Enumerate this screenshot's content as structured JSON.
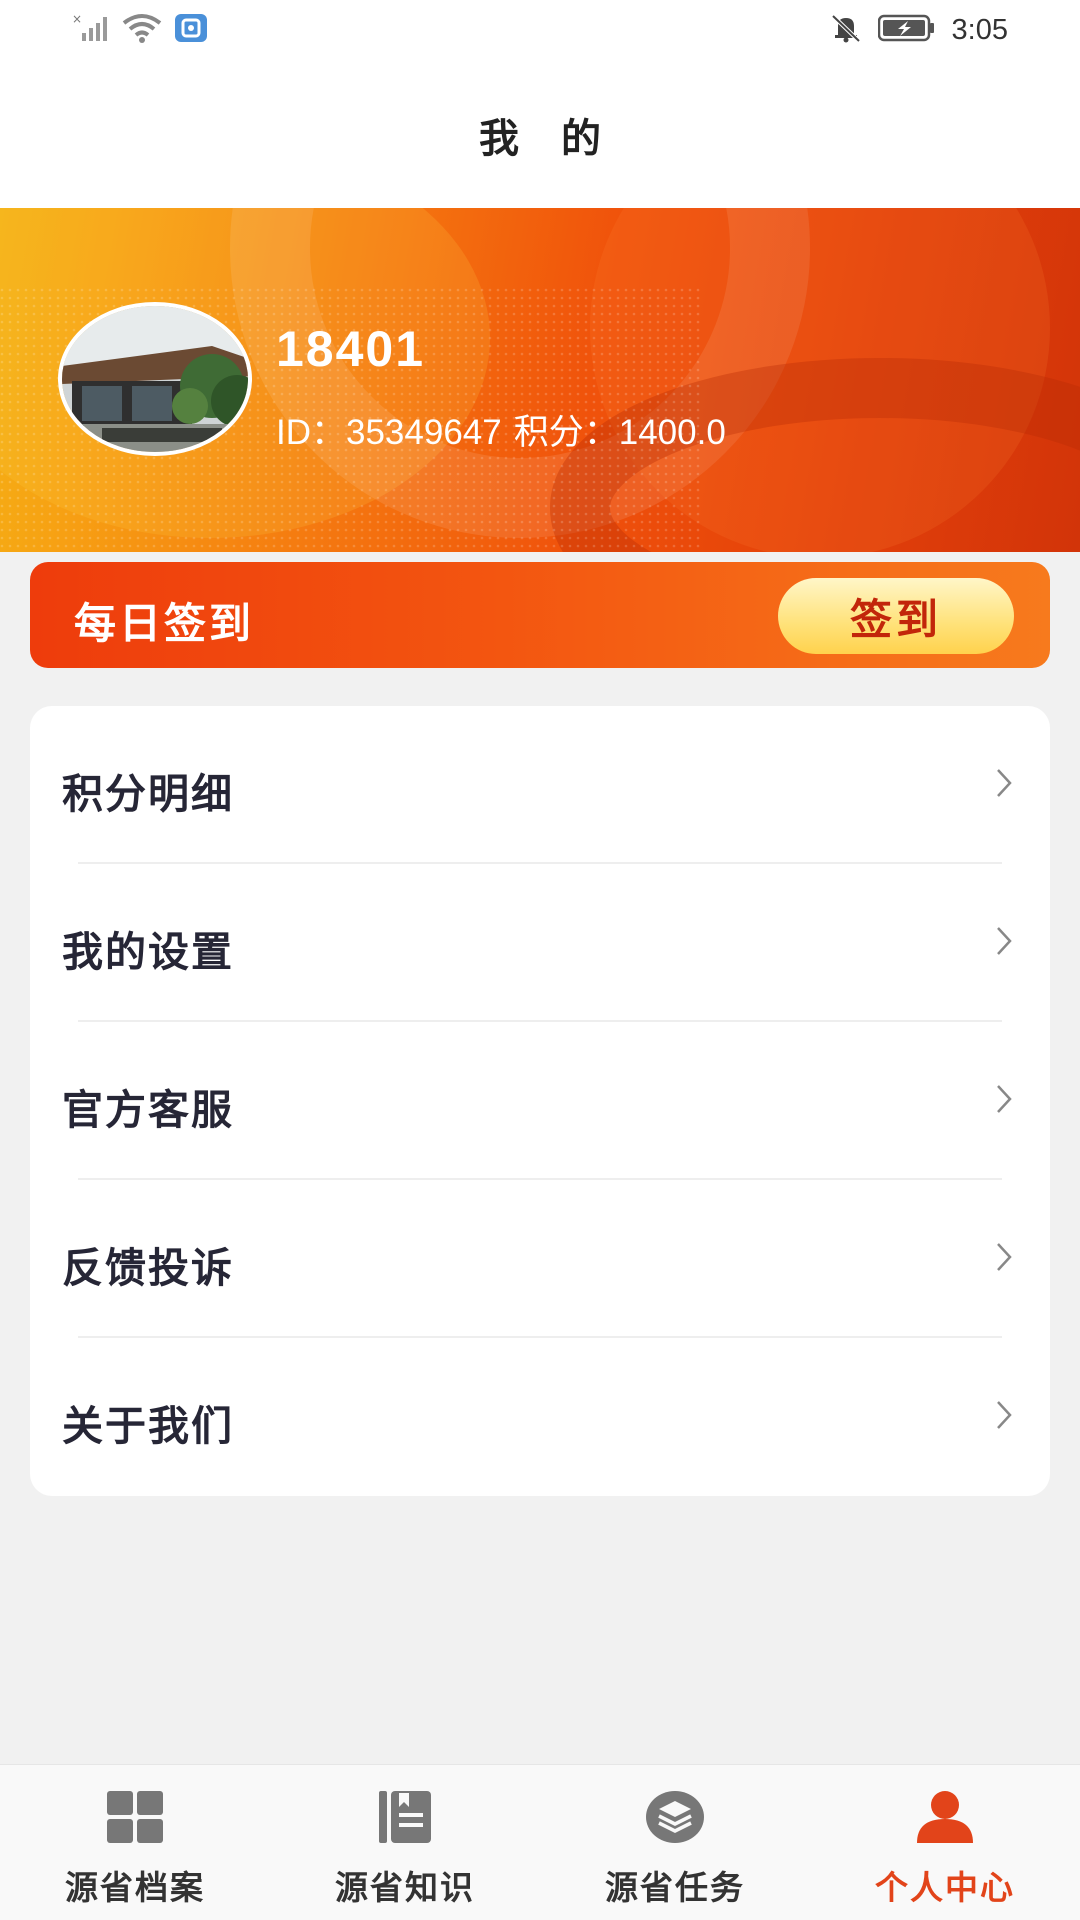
{
  "status_bar": {
    "time": "3:05",
    "left_icons": [
      "signal-off-icon",
      "wifi-icon",
      "app-notification-icon"
    ],
    "right_icons": [
      "notifications-muted-icon",
      "battery-charging-icon"
    ]
  },
  "header": {
    "title": "我 的"
  },
  "profile": {
    "username": "18401",
    "id_text": "ID：35349647",
    "points_text": "积分：1400.0"
  },
  "checkin": {
    "title": "每日签到",
    "button_label": "签到"
  },
  "menu": {
    "items": [
      {
        "label": "积分明细"
      },
      {
        "label": "我的设置"
      },
      {
        "label": "官方客服"
      },
      {
        "label": "反馈投诉"
      },
      {
        "label": "关于我们"
      }
    ]
  },
  "tabbar": {
    "items": [
      {
        "label": "源省档案",
        "icon": "grid-icon",
        "active": false
      },
      {
        "label": "源省知识",
        "icon": "book-icon",
        "active": false
      },
      {
        "label": "源省任务",
        "icon": "layers-icon",
        "active": false
      },
      {
        "label": "个人中心",
        "icon": "user-icon",
        "active": true
      }
    ]
  },
  "colors": {
    "accent": "#e2441a",
    "banner_start": "#f4b014",
    "banner_end": "#d23409",
    "checkin_button": "#ffe27a"
  }
}
